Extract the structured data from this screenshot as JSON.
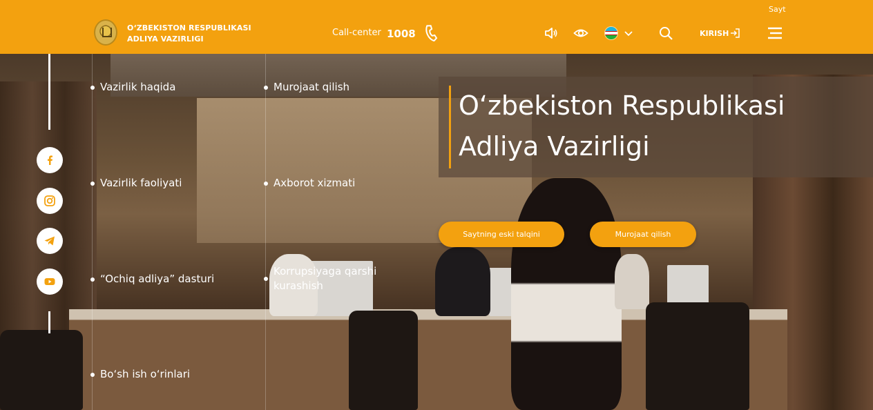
{
  "header": {
    "brand_line1": "O‘ZBEKISTON RESPUBLIKASI",
    "brand_line2": "ADLIYA VAZIRLIGI",
    "callcenter_label": "Call-center",
    "callcenter_number": "1008",
    "sayt_label": "Sayt",
    "login_label": "KIRISH",
    "icons": [
      "logo-emblem",
      "phone-icon",
      "speaker-icon",
      "eye-icon",
      "uzbekistan-flag-icon",
      "chevron-down-icon",
      "search-icon",
      "login-icon",
      "hamburger-menu-icon"
    ]
  },
  "menu": {
    "col1": [
      "Vazirlik haqida",
      "Vazirlik faoliyati",
      "“Ochiq adliya” dasturi",
      "Bo‘sh ish o‘rinlari"
    ],
    "col2": [
      "Murojaat qilish",
      "Axborot xizmati",
      "Korrupsiyaga qarshi kurashish"
    ]
  },
  "social": [
    "facebook-icon",
    "instagram-icon",
    "telegram-icon",
    "youtube-icon"
  ],
  "hero": {
    "title_line1": "O‘zbekiston Respublikasi",
    "title_line2": "Adliya Vazirligi",
    "button_old_site": "Saytning eski talqini",
    "button_appeal": "Murojaat qilish"
  },
  "colors": {
    "accent": "#f3a10f",
    "white": "#ffffff"
  }
}
